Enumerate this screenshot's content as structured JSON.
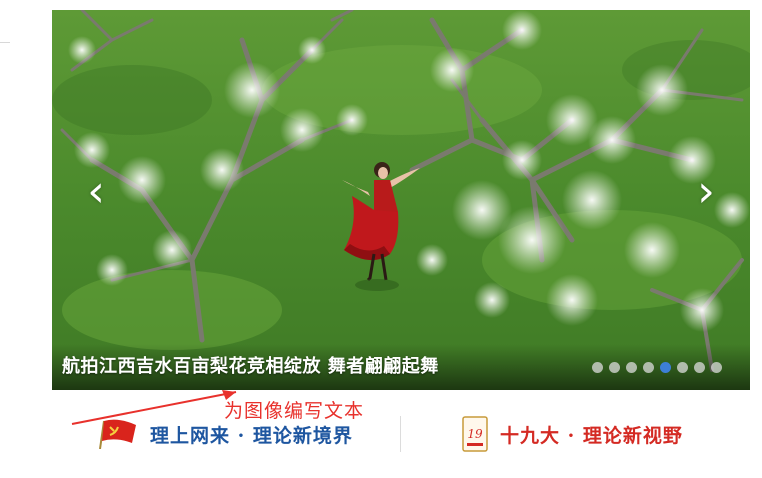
{
  "slider": {
    "caption": "航拍江西吉水百亩梨花竞相绽放 舞者翩翩起舞",
    "prev_arrow": "‹",
    "next_arrow": "›",
    "dots": [
      {
        "active": false
      },
      {
        "active": false
      },
      {
        "active": false
      },
      {
        "active": false
      },
      {
        "active": true
      },
      {
        "active": false
      },
      {
        "active": false
      },
      {
        "active": false
      }
    ]
  },
  "annotation": {
    "note": "为图像编写文本",
    "color": "#e8312c"
  },
  "banners": {
    "left": {
      "text": "理上网来 · 理论新境界",
      "icon": "party-flag-icon",
      "color": "#1e56a0"
    },
    "right": {
      "text": "十九大 · 理论新视野",
      "icon": "19th-congress-badge-icon",
      "badge_number": "19",
      "color": "#d42a23"
    }
  },
  "colors": {
    "active_dot": "#3d7fd6",
    "grass": "#4f8c2e"
  }
}
